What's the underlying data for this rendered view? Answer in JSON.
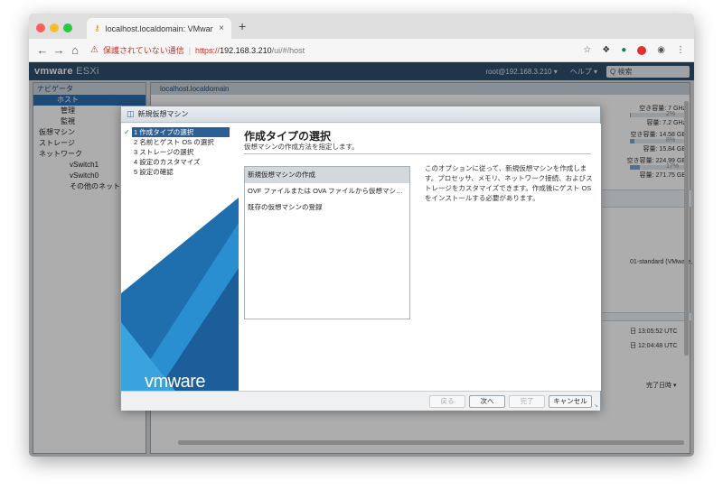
{
  "browser": {
    "tab_title": "localhost.localdomain: VMware",
    "tab_close": "×",
    "new_tab": "+",
    "security_warning": "保護されていない通信",
    "url_scheme": "https://",
    "url_host": "192.168.3.210",
    "url_path": "/ui/#/host"
  },
  "esxi": {
    "logo_main": "vmware",
    "logo_sub": "ESXi",
    "user": "root@192.168.3.210 ▾",
    "help": "ヘルプ ▾",
    "search_placeholder": "Q 検索"
  },
  "navigator": {
    "title": "ナビゲータ",
    "items": [
      {
        "label": "ホスト",
        "selected": true
      },
      {
        "label": "管理"
      },
      {
        "label": "監視"
      },
      {
        "label": "仮想マシン"
      },
      {
        "label": "ストレージ"
      },
      {
        "label": "ネットワーク"
      },
      {
        "label": "vSwitch1"
      },
      {
        "label": "vSwitch0"
      },
      {
        "label": "その他のネットワーク"
      }
    ]
  },
  "main": {
    "title": "localhost.localdomain",
    "resources": [
      {
        "free": "空き容量: 7 GHz",
        "pct": "2%",
        "cap": "容量: 7.2 GHz",
        "fill": 0.02
      },
      {
        "free": "空き容量: 14.58 GB",
        "pct": "8%",
        "cap": "容量: 15.84 GB",
        "fill": 0.08
      },
      {
        "free": "空き容量: 224.99 GB",
        "pct": "17%",
        "cap": "容量: 271.75 GB",
        "fill": 0.17
      }
    ],
    "peek_model": "01-standard (VMware,",
    "peek_time1": "日 13:05:52 UTC",
    "peek_time2": "日 12:04:48 UTC",
    "peek_col": "完了日時 ▾"
  },
  "dialog": {
    "title": "新規仮想マシン",
    "steps": [
      {
        "label": "1 作成タイプの選択",
        "active": true,
        "done": true
      },
      {
        "label": "2 名前とゲスト OS の選択"
      },
      {
        "label": "3 ストレージの選択"
      },
      {
        "label": "4 設定のカスタマイズ"
      },
      {
        "label": "5 設定の確認"
      }
    ],
    "heading": "作成タイプの選択",
    "subheading": "仮想マシンの作成方法を指定します。",
    "options": [
      {
        "label": "新規仮想マシンの作成",
        "selected": true
      },
      {
        "label": "OVF ファイルまたは OVA ファイルから仮想マシンをデプロイ"
      },
      {
        "label": "既存の仮想マシンの登録"
      }
    ],
    "description": "このオプションに従って、新規仮想マシンを作成します。プロセッサ、メモリ、ネットワーク接続、およびストレージをカスタマイズできます。作成後にゲスト OS をインストールする必要があります。",
    "brand": "vmware",
    "buttons": {
      "back": "戻る",
      "next": "次へ",
      "finish": "完了",
      "cancel": "キャンセル"
    }
  }
}
